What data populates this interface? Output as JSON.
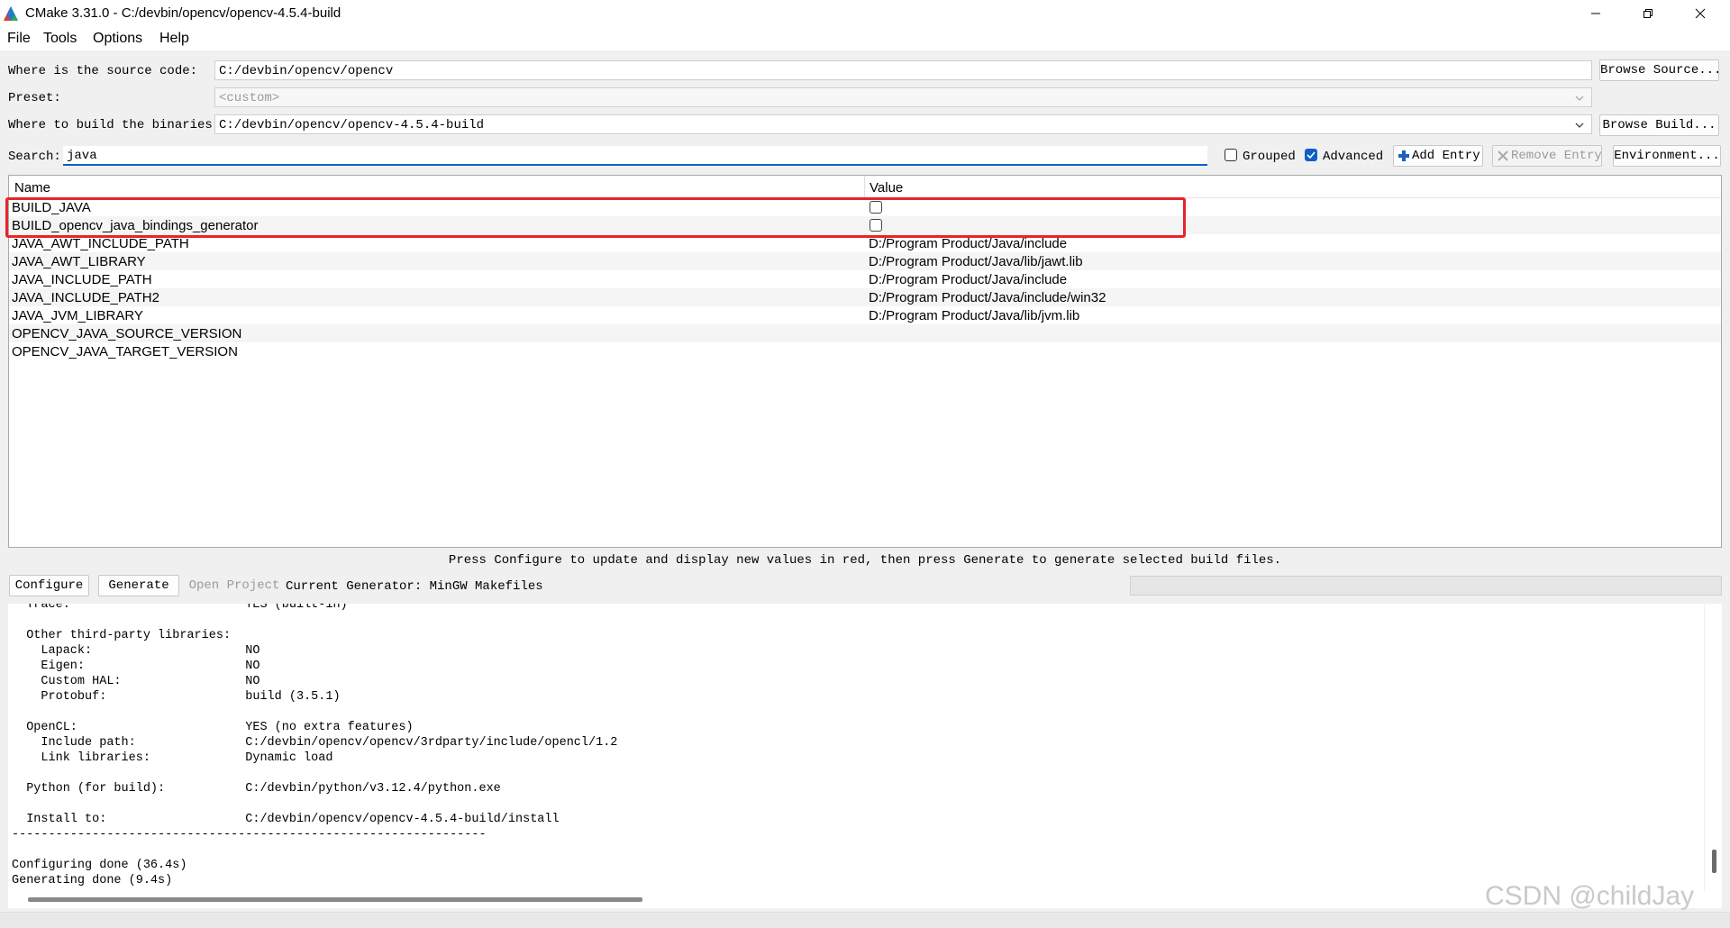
{
  "window": {
    "title": "CMake 3.31.0 - C:/devbin/opencv/opencv-4.5.4-build",
    "icons": {
      "app": "cmake-logo-icon",
      "minimize": "minimize-icon",
      "maximize": "restore-icon",
      "close": "close-icon"
    }
  },
  "menu": {
    "file": "File",
    "tools": "Tools",
    "options": "Options",
    "help": "Help"
  },
  "source": {
    "label": "Where is the source code:",
    "value": "C:/devbin/opencv/opencv",
    "browse_label": "Browse Source..."
  },
  "preset": {
    "label": "Preset:",
    "value": "<custom>"
  },
  "build": {
    "label": "Where to build the binaries:",
    "value": "C:/devbin/opencv/opencv-4.5.4-build",
    "browse_label": "Browse Build..."
  },
  "search": {
    "label": "Search:",
    "value": "java",
    "grouped_label": "Grouped",
    "grouped_checked": false,
    "advanced_label": "Advanced",
    "advanced_checked": true,
    "add_entry_label": "Add Entry",
    "remove_entry_label": "Remove Entry",
    "environment_label": "Environment..."
  },
  "table": {
    "col_name": "Name",
    "col_value": "Value",
    "rows": [
      {
        "name": "BUILD_JAVA",
        "value": "",
        "checkbox": true
      },
      {
        "name": "BUILD_opencv_java_bindings_generator",
        "value": "",
        "checkbox": true
      },
      {
        "name": "JAVA_AWT_INCLUDE_PATH",
        "value": "D:/Program Product/Java/include",
        "checkbox": false
      },
      {
        "name": "JAVA_AWT_LIBRARY",
        "value": "D:/Program Product/Java/lib/jawt.lib",
        "checkbox": false
      },
      {
        "name": "JAVA_INCLUDE_PATH",
        "value": "D:/Program Product/Java/include",
        "checkbox": false
      },
      {
        "name": "JAVA_INCLUDE_PATH2",
        "value": "D:/Program Product/Java/include/win32",
        "checkbox": false
      },
      {
        "name": "JAVA_JVM_LIBRARY",
        "value": "D:/Program Product/Java/lib/jvm.lib",
        "checkbox": false
      },
      {
        "name": "OPENCV_JAVA_SOURCE_VERSION",
        "value": "",
        "checkbox": false
      },
      {
        "name": "OPENCV_JAVA_TARGET_VERSION",
        "value": "",
        "checkbox": false
      }
    ]
  },
  "hint": "Press Configure to update and display new values in red, then press Generate to generate selected build files.",
  "actions": {
    "configure_label": "Configure",
    "generate_label": "Generate",
    "open_project_label": "Open Project",
    "generator_text": "Current Generator: MinGW Makefiles"
  },
  "log": [
    "  Trace:                        YES (built-in)",
    "",
    "  Other third-party libraries:",
    "    Lapack:                     NO",
    "    Eigen:                      NO",
    "    Custom HAL:                 NO",
    "    Protobuf:                   build (3.5.1)",
    "",
    "  OpenCL:                       YES (no extra features)",
    "    Include path:               C:/devbin/opencv/opencv/3rdparty/include/opencl/1.2",
    "    Link libraries:             Dynamic load",
    "",
    "  Python (for build):           C:/devbin/python/v3.12.4/python.exe",
    "",
    "  Install to:                   C:/devbin/opencv/opencv-4.5.4-build/install",
    "-----------------------------------------------------------------",
    "",
    "Configuring done (36.4s)",
    "Generating done (9.4s)"
  ],
  "watermark": "CSDN @childJay",
  "colors": {
    "highlight": "#e8242b",
    "checkbox_on": "#0f5ec8"
  }
}
